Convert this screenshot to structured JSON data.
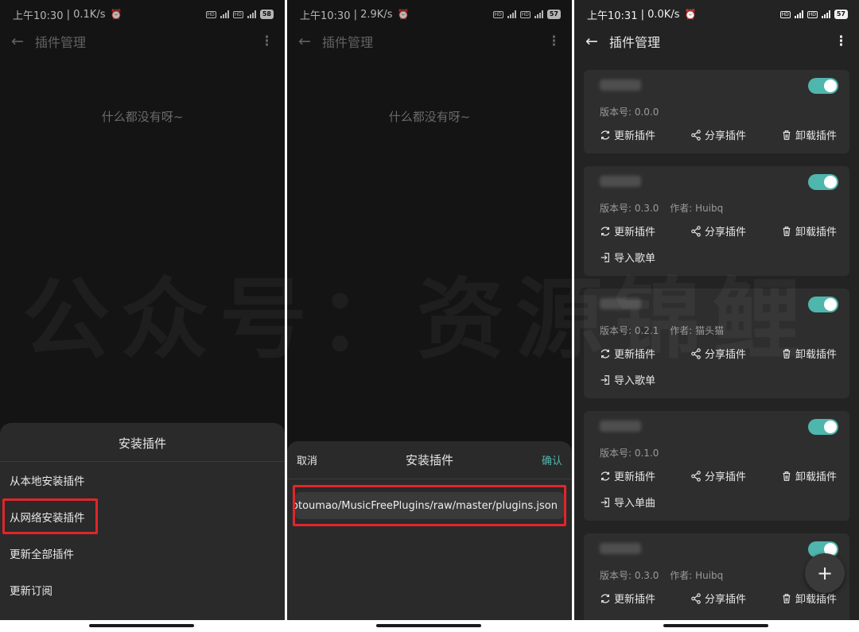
{
  "screens": [
    {
      "status": {
        "time": "上午10:30",
        "speed": "0.1K/s",
        "battery": "58"
      },
      "title": "插件管理",
      "empty_text": "什么都没有呀~",
      "sheet": {
        "title": "安装插件",
        "items": [
          "从本地安装插件",
          "从网络安装插件",
          "更新全部插件",
          "更新订阅"
        ]
      }
    },
    {
      "status": {
        "time": "上午10:30",
        "speed": "2.9K/s",
        "battery": "57"
      },
      "title": "插件管理",
      "empty_text": "什么都没有呀~",
      "sheet": {
        "cancel": "取消",
        "title": "安装插件",
        "confirm": "确认",
        "url": "otoumao/MusicFreePlugins/raw/master/plugins.json"
      }
    },
    {
      "status": {
        "time": "上午10:31",
        "speed": "0.0K/s",
        "battery": "57"
      },
      "title": "插件管理",
      "plugins": [
        {
          "version": "版本号: 0.0.0",
          "author": "",
          "extra": ""
        },
        {
          "version": "版本号: 0.3.0",
          "author": "作者: Huibq",
          "extra": "导入歌单"
        },
        {
          "version": "版本号: 0.2.1",
          "author": "作者: 猫头猫",
          "extra": "导入歌单"
        },
        {
          "version": "版本号: 0.1.0",
          "author": "",
          "extra": "导入单曲"
        },
        {
          "version": "版本号: 0.3.0",
          "author": "作者: Huibq",
          "extra": ""
        }
      ],
      "actions": {
        "update": "更新插件",
        "share": "分享插件",
        "uninstall": "卸载插件"
      },
      "fab": "+"
    }
  ],
  "watermark": "公众号：资源锦鲤",
  "colors": {
    "accent": "#4fb6ad",
    "highlight": "#e0262b",
    "background": "#1b1b1b",
    "card": "#2e2e2e"
  }
}
